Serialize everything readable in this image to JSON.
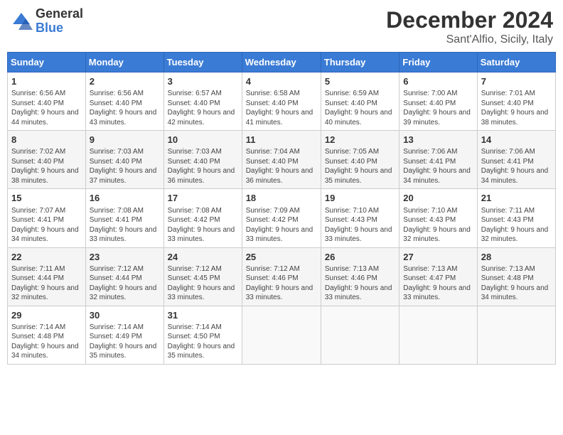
{
  "header": {
    "logo_general": "General",
    "logo_blue": "Blue",
    "month_title": "December 2024",
    "location": "Sant'Alfio, Sicily, Italy"
  },
  "weekdays": [
    "Sunday",
    "Monday",
    "Tuesday",
    "Wednesday",
    "Thursday",
    "Friday",
    "Saturday"
  ],
  "weeks": [
    [
      {
        "day": "1",
        "sunrise": "Sunrise: 6:56 AM",
        "sunset": "Sunset: 4:40 PM",
        "daylight": "Daylight: 9 hours and 44 minutes."
      },
      {
        "day": "2",
        "sunrise": "Sunrise: 6:56 AM",
        "sunset": "Sunset: 4:40 PM",
        "daylight": "Daylight: 9 hours and 43 minutes."
      },
      {
        "day": "3",
        "sunrise": "Sunrise: 6:57 AM",
        "sunset": "Sunset: 4:40 PM",
        "daylight": "Daylight: 9 hours and 42 minutes."
      },
      {
        "day": "4",
        "sunrise": "Sunrise: 6:58 AM",
        "sunset": "Sunset: 4:40 PM",
        "daylight": "Daylight: 9 hours and 41 minutes."
      },
      {
        "day": "5",
        "sunrise": "Sunrise: 6:59 AM",
        "sunset": "Sunset: 4:40 PM",
        "daylight": "Daylight: 9 hours and 40 minutes."
      },
      {
        "day": "6",
        "sunrise": "Sunrise: 7:00 AM",
        "sunset": "Sunset: 4:40 PM",
        "daylight": "Daylight: 9 hours and 39 minutes."
      },
      {
        "day": "7",
        "sunrise": "Sunrise: 7:01 AM",
        "sunset": "Sunset: 4:40 PM",
        "daylight": "Daylight: 9 hours and 38 minutes."
      }
    ],
    [
      {
        "day": "8",
        "sunrise": "Sunrise: 7:02 AM",
        "sunset": "Sunset: 4:40 PM",
        "daylight": "Daylight: 9 hours and 38 minutes."
      },
      {
        "day": "9",
        "sunrise": "Sunrise: 7:03 AM",
        "sunset": "Sunset: 4:40 PM",
        "daylight": "Daylight: 9 hours and 37 minutes."
      },
      {
        "day": "10",
        "sunrise": "Sunrise: 7:03 AM",
        "sunset": "Sunset: 4:40 PM",
        "daylight": "Daylight: 9 hours and 36 minutes."
      },
      {
        "day": "11",
        "sunrise": "Sunrise: 7:04 AM",
        "sunset": "Sunset: 4:40 PM",
        "daylight": "Daylight: 9 hours and 36 minutes."
      },
      {
        "day": "12",
        "sunrise": "Sunrise: 7:05 AM",
        "sunset": "Sunset: 4:40 PM",
        "daylight": "Daylight: 9 hours and 35 minutes."
      },
      {
        "day": "13",
        "sunrise": "Sunrise: 7:06 AM",
        "sunset": "Sunset: 4:41 PM",
        "daylight": "Daylight: 9 hours and 34 minutes."
      },
      {
        "day": "14",
        "sunrise": "Sunrise: 7:06 AM",
        "sunset": "Sunset: 4:41 PM",
        "daylight": "Daylight: 9 hours and 34 minutes."
      }
    ],
    [
      {
        "day": "15",
        "sunrise": "Sunrise: 7:07 AM",
        "sunset": "Sunset: 4:41 PM",
        "daylight": "Daylight: 9 hours and 34 minutes."
      },
      {
        "day": "16",
        "sunrise": "Sunrise: 7:08 AM",
        "sunset": "Sunset: 4:41 PM",
        "daylight": "Daylight: 9 hours and 33 minutes."
      },
      {
        "day": "17",
        "sunrise": "Sunrise: 7:08 AM",
        "sunset": "Sunset: 4:42 PM",
        "daylight": "Daylight: 9 hours and 33 minutes."
      },
      {
        "day": "18",
        "sunrise": "Sunrise: 7:09 AM",
        "sunset": "Sunset: 4:42 PM",
        "daylight": "Daylight: 9 hours and 33 minutes."
      },
      {
        "day": "19",
        "sunrise": "Sunrise: 7:10 AM",
        "sunset": "Sunset: 4:43 PM",
        "daylight": "Daylight: 9 hours and 33 minutes."
      },
      {
        "day": "20",
        "sunrise": "Sunrise: 7:10 AM",
        "sunset": "Sunset: 4:43 PM",
        "daylight": "Daylight: 9 hours and 32 minutes."
      },
      {
        "day": "21",
        "sunrise": "Sunrise: 7:11 AM",
        "sunset": "Sunset: 4:43 PM",
        "daylight": "Daylight: 9 hours and 32 minutes."
      }
    ],
    [
      {
        "day": "22",
        "sunrise": "Sunrise: 7:11 AM",
        "sunset": "Sunset: 4:44 PM",
        "daylight": "Daylight: 9 hours and 32 minutes."
      },
      {
        "day": "23",
        "sunrise": "Sunrise: 7:12 AM",
        "sunset": "Sunset: 4:44 PM",
        "daylight": "Daylight: 9 hours and 32 minutes."
      },
      {
        "day": "24",
        "sunrise": "Sunrise: 7:12 AM",
        "sunset": "Sunset: 4:45 PM",
        "daylight": "Daylight: 9 hours and 33 minutes."
      },
      {
        "day": "25",
        "sunrise": "Sunrise: 7:12 AM",
        "sunset": "Sunset: 4:46 PM",
        "daylight": "Daylight: 9 hours and 33 minutes."
      },
      {
        "day": "26",
        "sunrise": "Sunrise: 7:13 AM",
        "sunset": "Sunset: 4:46 PM",
        "daylight": "Daylight: 9 hours and 33 minutes."
      },
      {
        "day": "27",
        "sunrise": "Sunrise: 7:13 AM",
        "sunset": "Sunset: 4:47 PM",
        "daylight": "Daylight: 9 hours and 33 minutes."
      },
      {
        "day": "28",
        "sunrise": "Sunrise: 7:13 AM",
        "sunset": "Sunset: 4:48 PM",
        "daylight": "Daylight: 9 hours and 34 minutes."
      }
    ],
    [
      {
        "day": "29",
        "sunrise": "Sunrise: 7:14 AM",
        "sunset": "Sunset: 4:48 PM",
        "daylight": "Daylight: 9 hours and 34 minutes."
      },
      {
        "day": "30",
        "sunrise": "Sunrise: 7:14 AM",
        "sunset": "Sunset: 4:49 PM",
        "daylight": "Daylight: 9 hours and 35 minutes."
      },
      {
        "day": "31",
        "sunrise": "Sunrise: 7:14 AM",
        "sunset": "Sunset: 4:50 PM",
        "daylight": "Daylight: 9 hours and 35 minutes."
      },
      null,
      null,
      null,
      null
    ]
  ]
}
